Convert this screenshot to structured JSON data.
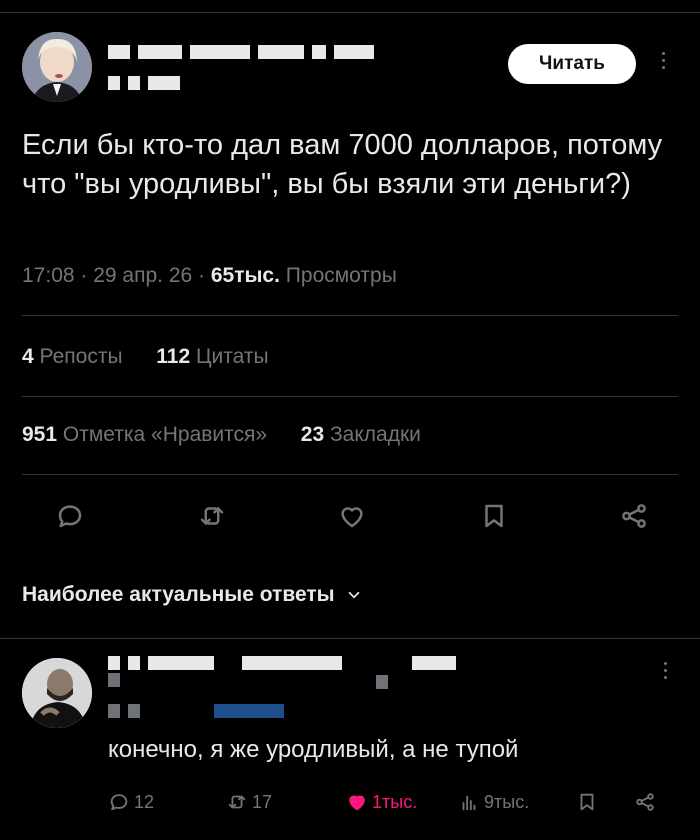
{
  "post": {
    "follow_label": "Читать",
    "text": "Если бы кто-то дал вам 7000 долларов, потому что \"вы уродливы\", вы бы взяли эти деньги?)",
    "time": "17:08",
    "date": "29 апр. 26",
    "views_count": "65тыс.",
    "views_label": "Просмотры",
    "reposts_count": "4",
    "reposts_label": "Репосты",
    "quotes_count": "112",
    "quotes_label": "Цитаты",
    "likes_count": "951",
    "likes_label": "Отметка «Нравится»",
    "bookmarks_count": "23",
    "bookmarks_label": "Закладки"
  },
  "replies_sort_label": "Наиболее актуальные ответы",
  "reply": {
    "text": "конечно, я же уродливый, а не тупой",
    "reply_count": "12",
    "repost_count": "17",
    "like_count": "1тыс.",
    "views_count": "9тыс."
  },
  "colors": {
    "background": "#000000",
    "text": "#e7e9ea",
    "secondary": "#71767b",
    "divider": "#2f3336",
    "like": "#f91880"
  },
  "icons": {
    "reply": "reply-icon",
    "repost": "repost-icon",
    "like": "heart-icon",
    "bookmark": "bookmark-icon",
    "share": "share-icon",
    "views": "views-chart-icon",
    "more": "more-vertical-icon",
    "sort": "chevron-down-icon"
  }
}
